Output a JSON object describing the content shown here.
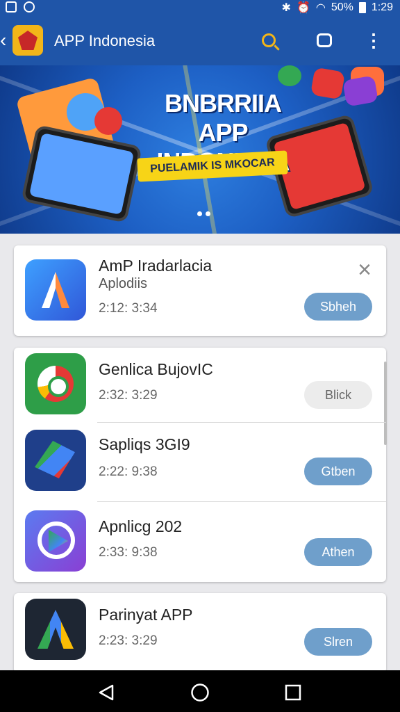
{
  "status_bar": {
    "battery": "50%",
    "time": "1:29"
  },
  "app_bar": {
    "title": "APP Indonesia"
  },
  "banner": {
    "title_line1": "BNBRRIIA",
    "title_line2": "APP INDONESIA",
    "tagline": "PUELAMIK IS MKOCAR",
    "page_count": 2
  },
  "cards": {
    "featured": {
      "name": "AmP Iradarlacia",
      "subtitle": "Aplodiis",
      "time": "2:12: 3:34",
      "action": "Sbheh",
      "icon": "app-a-icon"
    },
    "apps": [
      {
        "name": "Genlica BujovIC",
        "time": "2:32: 3:29",
        "action": "Blick",
        "icon": "chrome-icon"
      },
      {
        "name": "Sapliqs 3GI9",
        "time": "2:22: 9:38",
        "action": "Gtben",
        "icon": "maps-icon"
      },
      {
        "name": "Apnlicg 202",
        "time": "2:33: 9:38",
        "action": "Athen",
        "icon": "play-icon"
      }
    ],
    "last": {
      "name": "Parinyat APP",
      "time": "2:23: 3:29",
      "action": "Slren",
      "icon": "adwords-icon"
    }
  },
  "colors": {
    "app_bar": "#1f55a8",
    "accent_yellow": "#f2b519",
    "pill_blue": "#6f9fcb"
  }
}
